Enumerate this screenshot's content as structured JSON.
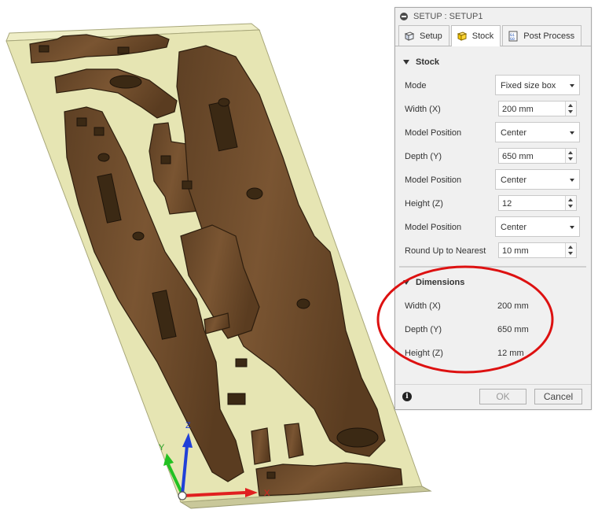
{
  "dialog": {
    "title": "SETUP : SETUP1",
    "tabs": [
      {
        "label": "Setup",
        "icon": "setup-cube-icon"
      },
      {
        "label": "Stock",
        "icon": "stock-cube-icon"
      },
      {
        "label": "Post Process",
        "icon": "post-process-icon"
      }
    ],
    "stock_section": {
      "heading": "Stock",
      "mode_label": "Mode",
      "mode_value": "Fixed size box",
      "width_label": "Width (X)",
      "width_value": "200 mm",
      "model_pos_x_label": "Model Position",
      "model_pos_x_value": "Center",
      "depth_label": "Depth (Y)",
      "depth_value": "650 mm",
      "model_pos_y_label": "Model Position",
      "model_pos_y_value": "Center",
      "height_label": "Height (Z)",
      "height_value": "12",
      "model_pos_z_label": "Model Position",
      "model_pos_z_value": "Center",
      "round_label": "Round Up to Nearest",
      "round_value": "10 mm"
    },
    "dimensions_section": {
      "heading": "Dimensions",
      "width_label": "Width (X)",
      "width_value": "200 mm",
      "depth_label": "Depth (Y)",
      "depth_value": "650 mm",
      "height_label": "Height (Z)",
      "height_value": "12 mm"
    },
    "footer": {
      "ok_label": "OK",
      "cancel_label": "Cancel"
    }
  },
  "viewport": {
    "axis_x_label": "X",
    "axis_y_label": "Y",
    "axis_z_label": "Z",
    "colors": {
      "stock": "#e6e5b3",
      "wood": "#6b4a2a",
      "wood_dark": "#3f2a14",
      "annotation": "#dd1111"
    }
  }
}
